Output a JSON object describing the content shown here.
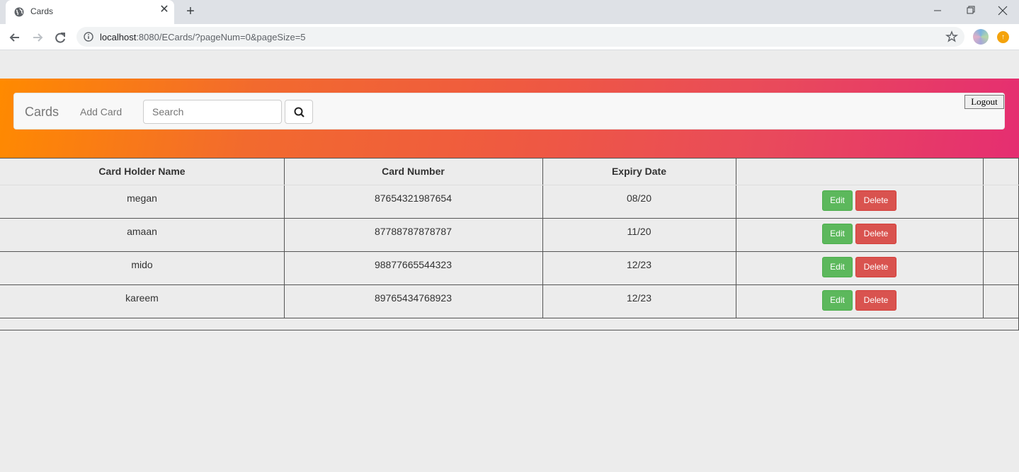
{
  "browser": {
    "tab_title": "Cards",
    "url_host": "localhost",
    "url_rest": ":8080/ECards/?pageNum=0&pageSize=5"
  },
  "navbar": {
    "brand": "Cards",
    "add_card": "Add Card",
    "search_placeholder": "Search",
    "logout": "Logout"
  },
  "table": {
    "headers": [
      "Card Holder Name",
      "Card Number",
      "Expiry Date",
      ""
    ],
    "rows": [
      {
        "name": "megan",
        "number": "87654321987654",
        "expiry": "08/20"
      },
      {
        "name": "amaan",
        "number": "87788787878787",
        "expiry": "11/20"
      },
      {
        "name": "mido",
        "number": "98877665544323",
        "expiry": "12/23"
      },
      {
        "name": "kareem",
        "number": "89765434768923",
        "expiry": "12/23"
      }
    ],
    "edit_label": "Edit",
    "delete_label": "Delete"
  },
  "colors": {
    "gradient_start": "#ff8a00",
    "gradient_end": "#e52e71",
    "edit": "#5cb85c",
    "delete": "#d9534f"
  }
}
